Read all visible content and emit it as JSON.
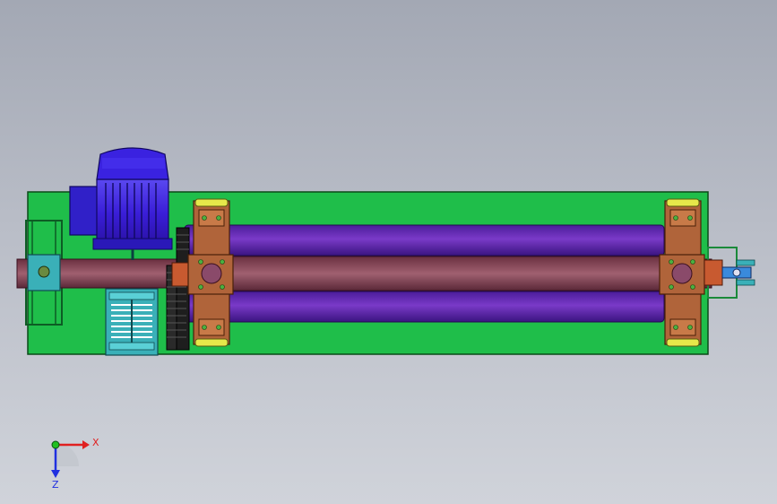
{
  "viewport": {
    "name": "3d-model-viewport",
    "background_top": "#a3a8b4",
    "background_bottom": "#d0d3da"
  },
  "triad": {
    "x_label": "X",
    "z_label": "Z",
    "x_color": "#e02020",
    "y_color": "#20c020",
    "z_color": "#2030e0"
  },
  "colors": {
    "base_plate": "#1fbe4a",
    "motor": "#3a1ed8",
    "rollers": "#6a2ab0",
    "shaft": "#8a4a5a",
    "bearing_blocks": "#b0643a",
    "teal_parts": "#3ab0b8",
    "bearing_caps": "#e6e84a",
    "gears": "#2a2a2a"
  }
}
